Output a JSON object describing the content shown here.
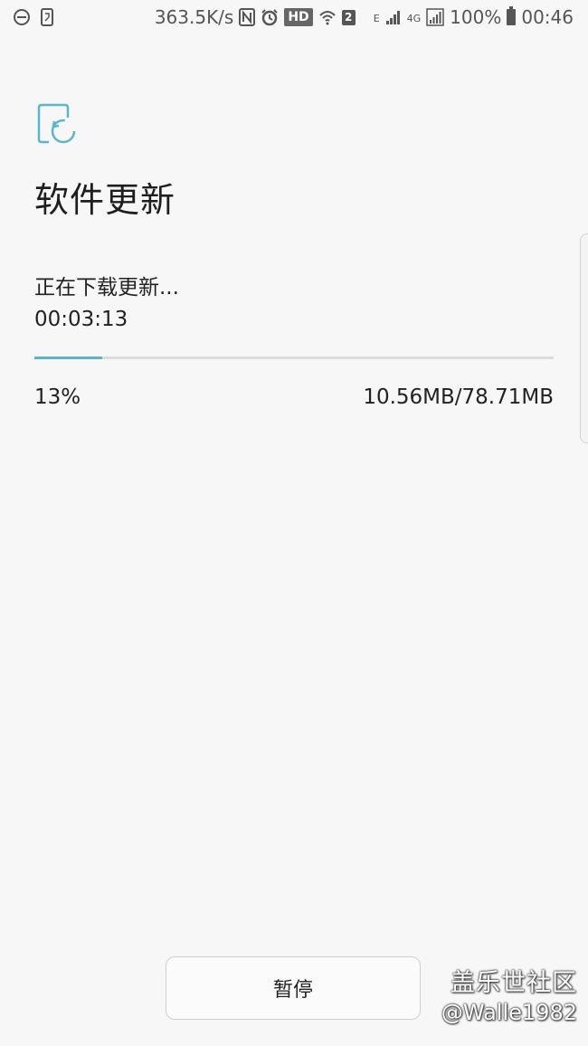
{
  "status_bar": {
    "net_speed": "363.5K/s",
    "hd_label": "HD",
    "sim_label": "2",
    "e_label": "E",
    "lte_label": "4G",
    "battery_percent": "100%",
    "time": "00:46",
    "icons": [
      "do-not-disturb-icon",
      "screenshot-icon",
      "nfc-icon",
      "alarm-icon",
      "hd-voice-icon",
      "wifi-icon",
      "sim-icon",
      "signal-icon",
      "signal-4g-icon",
      "battery-icon"
    ]
  },
  "page": {
    "title": "软件更新",
    "status_text": "正在下载更新...",
    "elapsed_time": "00:03:13",
    "progress_fraction": 0.13,
    "percent_text": "13%",
    "size_text": "10.56MB/78.71MB"
  },
  "footer": {
    "pause_label": "暂停"
  },
  "watermark": {
    "line1": "盖乐世社区",
    "line2": "@Walle1982"
  },
  "colors": {
    "accent": "#5ab6cc",
    "background": "#f7f7f7"
  }
}
